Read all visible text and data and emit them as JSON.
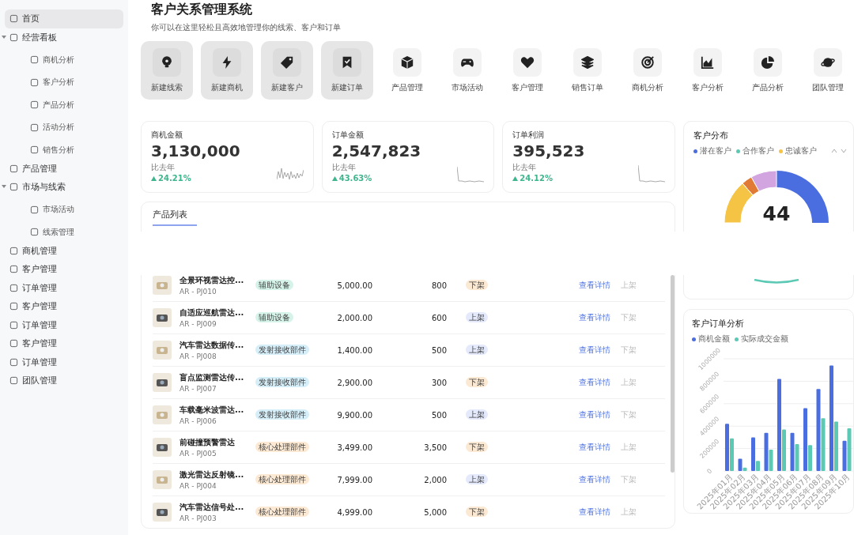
{
  "sidebar": {
    "items": [
      {
        "label": "首页",
        "selected": true
      },
      {
        "label": "经营看板",
        "selected": false,
        "expanded": true,
        "children": [
          {
            "label": "商机分析",
            "selected": false
          },
          {
            "label": "客户分析",
            "selected": false
          },
          {
            "label": "产品分析",
            "selected": false
          },
          {
            "label": "活动分析",
            "selected": false
          },
          {
            "label": "销售分析",
            "selected": false
          }
        ]
      },
      {
        "label": "产品管理",
        "selected": false
      },
      {
        "label": "市场与线索",
        "selected": false,
        "expanded": true,
        "children": [
          {
            "label": "市场活动",
            "selected": false
          },
          {
            "label": "线索管理",
            "selected": false
          }
        ]
      },
      {
        "label": "商机管理",
        "selected": false
      },
      {
        "label": "客户管理",
        "selected": false
      },
      {
        "label": "订单管理",
        "selected": false
      },
      {
        "label": "客户管理",
        "selected": false
      },
      {
        "label": "订单管理",
        "selected": false
      },
      {
        "label": "客户管理",
        "selected": false
      },
      {
        "label": "订单管理",
        "selected": false
      },
      {
        "label": "团队管理",
        "selected": false
      }
    ]
  },
  "header": {
    "title": "客户关系管理系统",
    "subtitle": "你可以在这里轻松且高效地管理你的线索、客户和订单"
  },
  "quick_actions": [
    {
      "label": "新建线索",
      "kind": "tile"
    },
    {
      "label": "新建商机",
      "kind": "tile"
    },
    {
      "label": "新建客户",
      "kind": "tile"
    },
    {
      "label": "新建订单",
      "kind": "tile"
    },
    {
      "label": "产品管理",
      "kind": "plain"
    },
    {
      "label": "市场活动",
      "kind": "plain"
    },
    {
      "label": "客户管理",
      "kind": "plain"
    },
    {
      "label": "销售订单",
      "kind": "plain"
    },
    {
      "label": "商机分析",
      "kind": "plain"
    },
    {
      "label": "客户分析",
      "kind": "plain"
    },
    {
      "label": "产品分析",
      "kind": "plain"
    },
    {
      "label": "团队管理",
      "kind": "plain"
    }
  ],
  "stats": [
    {
      "label": "商机金额",
      "value": "3,130,000",
      "compare_label": "比去年",
      "change": "24.21%"
    },
    {
      "label": "订单金额",
      "value": "2,547,823",
      "compare_label": "比去年",
      "change": "43.63%"
    },
    {
      "label": "订单利润",
      "value": "395,523",
      "compare_label": "比去年",
      "change": "24.12%"
    }
  ],
  "product_list": {
    "title": "产品列表",
    "rows": [
      {
        "name": "全景环视雷达控...",
        "code": "AR - PJ010",
        "category": {
          "label": "辅助设备",
          "color": "#d6f3ea"
        },
        "price": "5,000.00",
        "stock": "800",
        "status": "下架",
        "on_shelf": false,
        "detail_action": "查看详情",
        "toggle_action": "上架"
      },
      {
        "name": "自适应巡航雷达...",
        "code": "AR - PJ009",
        "category": {
          "label": "辅助设备",
          "color": "#d6f3ea"
        },
        "price": "2,000.00",
        "stock": "600",
        "status": "上架",
        "on_shelf": true,
        "detail_action": "查看详情",
        "toggle_action": "下架"
      },
      {
        "name": "汽车雷达数据传...",
        "code": "AR - PJ008",
        "category": {
          "label": "发射接收部件",
          "color": "#d5eef8"
        },
        "price": "1,400.00",
        "stock": "500",
        "status": "上架",
        "on_shelf": true,
        "detail_action": "查看详情",
        "toggle_action": "下架"
      },
      {
        "name": "盲点监测雷达传...",
        "code": "AR - PJ007",
        "category": {
          "label": "发射接收部件",
          "color": "#d5eef8"
        },
        "price": "2,900.00",
        "stock": "300",
        "status": "下架",
        "on_shelf": false,
        "detail_action": "查看详情",
        "toggle_action": "上架"
      },
      {
        "name": "车载毫米波雷达...",
        "code": "AR - PJ006",
        "category": {
          "label": "发射接收部件",
          "color": "#d5eef8"
        },
        "price": "9,900.00",
        "stock": "500",
        "status": "上架",
        "on_shelf": true,
        "detail_action": "查看详情",
        "toggle_action": "下架"
      },
      {
        "name": "前碰撞预警雷达",
        "code": "AR - PJ005",
        "category": {
          "label": "核心处理部件",
          "color": "#fbe9d4"
        },
        "price": "3,499.00",
        "stock": "3,500",
        "status": "下架",
        "on_shelf": false,
        "detail_action": "查看详情",
        "toggle_action": "上架"
      },
      {
        "name": "激光雷达反射镜...",
        "code": "AR - PJ004",
        "category": {
          "label": "核心处理部件",
          "color": "#fbe9d4"
        },
        "price": "7,999.00",
        "stock": "2,000",
        "status": "上架",
        "on_shelf": true,
        "detail_action": "查看详情",
        "toggle_action": "下架"
      },
      {
        "name": "汽车雷达信号处...",
        "code": "AR - PJ003",
        "category": {
          "label": "核心处理部件",
          "color": "#fbe9d4"
        },
        "price": "4,999.00",
        "stock": "5,000",
        "status": "下架",
        "on_shelf": false,
        "detail_action": "查看详情",
        "toggle_action": "上架"
      }
    ]
  },
  "customer_distribution": {
    "title": "客户分布",
    "value": "44",
    "legend": [
      {
        "label": "潜在客户",
        "color": "#4a6ee0"
      },
      {
        "label": "合作客户",
        "color": "#5cc9b5"
      },
      {
        "label": "忠诚客户",
        "color": "#f5c445"
      }
    ]
  },
  "order_analysis": {
    "title": "客户订单分析",
    "chart_data": {
      "type": "bar",
      "categories": [
        "2025年01月",
        "2025年02月",
        "2025年03月",
        "2025年04月",
        "2025年05月",
        "2025年06月",
        "2025年07月",
        "2025年08月",
        "2025年09月",
        "2025年10月"
      ],
      "yticks": [
        0,
        200000,
        400000,
        600000,
        800000,
        1000000
      ],
      "ylim": [
        0,
        1000000
      ],
      "grid": true,
      "series": [
        {
          "name": "商机金额",
          "color": "#4a6ee0",
          "values": [
            420000,
            110000,
            300000,
            340000,
            820000,
            340000,
            560000,
            730000,
            940000,
            270000
          ]
        },
        {
          "name": "实际成交金额",
          "color": "#5cc9b5",
          "values": [
            290000,
            30000,
            90000,
            190000,
            370000,
            240000,
            230000,
            470000,
            440000,
            380000
          ]
        }
      ]
    }
  }
}
